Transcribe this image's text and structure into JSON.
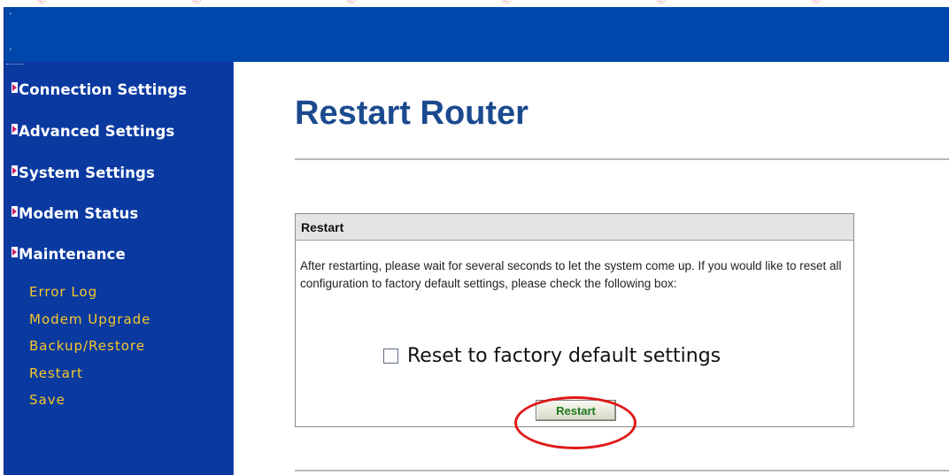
{
  "sidebar": {
    "menu": [
      {
        "label": "Connection Settings"
      },
      {
        "label": "Advanced Settings"
      },
      {
        "label": "System Settings"
      },
      {
        "label": "Modem Status"
      },
      {
        "label": "Maintenance"
      }
    ],
    "maintenance_items": [
      {
        "label": "Error Log"
      },
      {
        "label": "Modem Upgrade"
      },
      {
        "label": "Backup/Restore"
      },
      {
        "label": "Restart"
      },
      {
        "label": "Save"
      }
    ]
  },
  "main": {
    "title": "Restart Router",
    "panel": {
      "heading": "Restart",
      "description": "After restarting, please wait for several seconds to let the system come up. If you would like to reset all configuration to factory default settings, please check the following box:",
      "checkbox_label": "Reset to factory default settings",
      "checkbox_checked": false,
      "button_label": "Restart"
    }
  },
  "colors": {
    "header": "#0047ab",
    "sidebar": "#0a3aa0",
    "submenu_text": "#f7c82a",
    "title": "#1b4a8f",
    "button_text": "#1c7a1c",
    "annotation": "#e01818"
  },
  "icons": {
    "menu_bullet": "arrow-bullet-icon"
  }
}
